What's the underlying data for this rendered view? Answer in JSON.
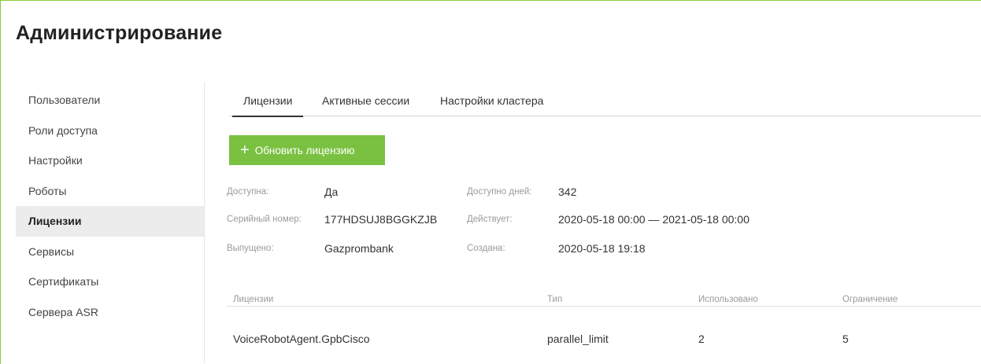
{
  "header": {
    "title": "Администрирование"
  },
  "sidebar": {
    "items": [
      {
        "label": "Пользователи"
      },
      {
        "label": "Роли доступа"
      },
      {
        "label": "Настройки"
      },
      {
        "label": "Роботы"
      },
      {
        "label": "Лицензии",
        "active": true
      },
      {
        "label": "Сервисы"
      },
      {
        "label": "Сертификаты"
      },
      {
        "label": "Сервера ASR"
      }
    ]
  },
  "tabs": [
    {
      "label": "Лицензии",
      "active": true
    },
    {
      "label": "Активные сессии"
    },
    {
      "label": "Настройки кластера"
    }
  ],
  "update_button": {
    "icon": "plus-icon",
    "label": "Обновить лицензию",
    "color": "#7ac142"
  },
  "license_info": {
    "available_label": "Доступна:",
    "available_value": "Да",
    "serial_label": "Серийный номер:",
    "serial_value": "177HDSUJ8BGGKZJB",
    "issued_label": "Выпущено:",
    "issued_value": "Gazprombank",
    "days_label": "Доступно дней:",
    "days_value": "342",
    "valid_label": "Действует:",
    "valid_value": "2020-05-18 00:00 — 2021-05-18 00:00",
    "created_label": "Создана:",
    "created_value": "2020-05-18 19:18"
  },
  "table": {
    "columns": [
      "Лицензии",
      "Тип",
      "Использовано",
      "Ограничение"
    ],
    "rows": [
      [
        "VoiceRobotAgent.GpbCisco",
        "parallel_limit",
        "2",
        "5"
      ]
    ]
  },
  "colors": {
    "accent": "#7ac142",
    "frame": "#8cc63f"
  }
}
